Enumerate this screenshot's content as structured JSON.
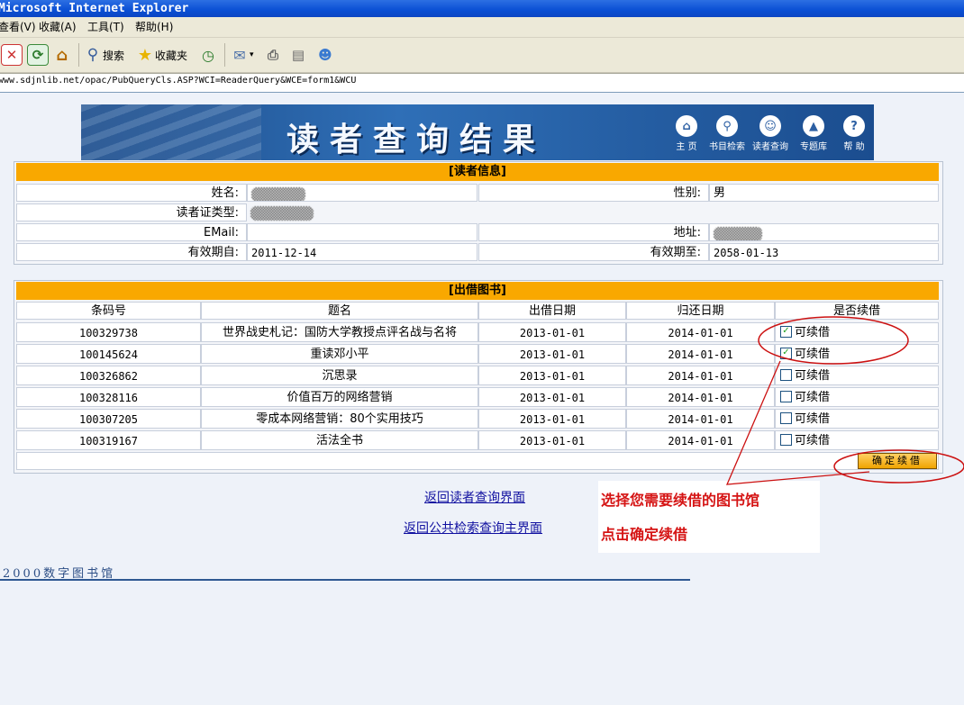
{
  "window": {
    "title": "Microsoft Internet Explorer"
  },
  "menu": [
    "查看(V)",
    "收藏(A)",
    "工具(T)",
    "帮助(H)"
  ],
  "toolbar": {
    "search": "搜索",
    "favorites": "收藏夹"
  },
  "address": "www.sdjnlib.net/opac/PubQueryCls.ASP?WCI=ReaderQuery&WCE=form1&WCU",
  "banner": {
    "title": "读者查询结果",
    "nav": [
      "主 页",
      "书目检索",
      "读者查询",
      "专题库",
      "帮 助"
    ]
  },
  "reader": {
    "section": "[读者信息]",
    "name_label": "姓名:",
    "gender_label": "性别:",
    "gender": "男",
    "card_type_label": "读者证类型:",
    "email_label": "EMail:",
    "address_label": "地址:",
    "valid_from_label": "有效期自:",
    "valid_from": "2011-12-14",
    "valid_to_label": "有效期至:",
    "valid_to": "2058-01-13"
  },
  "loans": {
    "section": "[出借图书]",
    "columns": [
      "条码号",
      "题名",
      "出借日期",
      "归还日期",
      "是否续借"
    ],
    "rows": [
      {
        "barcode": "100329738",
        "title": "世界战史札记：国防大学教授点评名战与名将",
        "out": "2013-01-01",
        "due": "2014-01-01",
        "renew": "可续借",
        "checked": true
      },
      {
        "barcode": "100145624",
        "title": "重读邓小平",
        "out": "2013-01-01",
        "due": "2014-01-01",
        "renew": "可续借",
        "checked": true
      },
      {
        "barcode": "100326862",
        "title": "沉思录",
        "out": "2013-01-01",
        "due": "2014-01-01",
        "renew": "可续借",
        "checked": false
      },
      {
        "barcode": "100328116",
        "title": "价值百万的网络营销",
        "out": "2013-01-01",
        "due": "2014-01-01",
        "renew": "可续借",
        "checked": false
      },
      {
        "barcode": "100307205",
        "title": "零成本网络营销：80个实用技巧",
        "out": "2013-01-01",
        "due": "2014-01-01",
        "renew": "可续借",
        "checked": false
      },
      {
        "barcode": "100319167",
        "title": "活法全书",
        "out": "2013-01-01",
        "due": "2014-01-01",
        "renew": "可续借",
        "checked": false
      }
    ],
    "confirm_button": "确定续借"
  },
  "links": {
    "back_reader": "返回读者查询界面",
    "back_opac": "返回公共检索查询主界面"
  },
  "annotation": {
    "line1": "选择您需要续借的图书馆",
    "line2": "点击确定续借"
  },
  "footer_logo": "2000数字图书馆"
}
